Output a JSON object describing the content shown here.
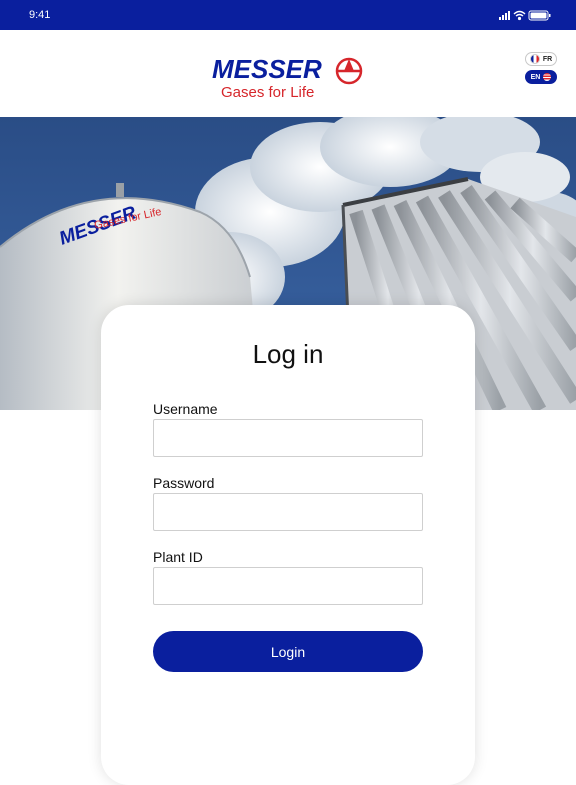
{
  "status_bar": {
    "time": "9:41"
  },
  "brand": {
    "name": "MESSER",
    "tagline": "Gases for Life"
  },
  "hero": {
    "tank_brand": "MESSER",
    "tank_tagline": "Gases for Life"
  },
  "languages": [
    {
      "code": "FR",
      "flag": "france-flag-icon",
      "selected": false
    },
    {
      "code": "EN",
      "flag": "us-flag-icon",
      "selected": true
    }
  ],
  "login": {
    "title": "Log in",
    "fields": [
      {
        "label": "Username",
        "value": "",
        "placeholder": ""
      },
      {
        "label": "Password",
        "value": "",
        "placeholder": ""
      },
      {
        "label": "Plant ID",
        "value": "",
        "placeholder": ""
      }
    ],
    "submit_label": "Login"
  },
  "colors": {
    "primary": "#0a1f9e",
    "brand_red": "#d6262b",
    "sky": "#2a4d86"
  }
}
